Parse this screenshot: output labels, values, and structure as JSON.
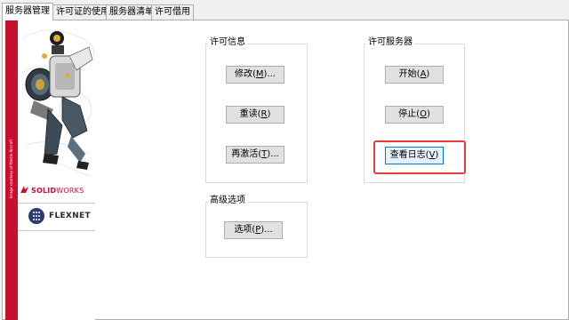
{
  "tabs": [
    {
      "label": "服务器管理",
      "active": true
    },
    {
      "label": "许可证的使用",
      "active": false
    },
    {
      "label": "服务器清单",
      "active": false
    },
    {
      "label": "许可借用",
      "active": false
    }
  ],
  "banner": {
    "logo_text_solid": "SOLID",
    "logo_text_works": "WORKS",
    "flex_logo_text": "FLEXNET",
    "vertical_caption": "Image courtesy of Martin Aircraft"
  },
  "license_info": {
    "title": "许可信息",
    "modify": {
      "label": "修改(",
      "key": "M",
      "suffix": ")..."
    },
    "reread": {
      "label": "重读(",
      "key": "R",
      "suffix": ")"
    },
    "reactivate": {
      "label": "再激活(",
      "key": "T",
      "suffix": ")..."
    }
  },
  "license_server": {
    "title": "许可服务器",
    "start": {
      "label": "开始(",
      "key": "A",
      "suffix": ")"
    },
    "stop": {
      "label": "停止(",
      "key": "O",
      "suffix": ")"
    },
    "view_log": {
      "label": "查看日志(",
      "key": "V",
      "suffix": ")"
    }
  },
  "advanced": {
    "title": "高级选项",
    "options": {
      "label": "选项(",
      "key": "P",
      "suffix": ")..."
    }
  },
  "colors": {
    "brand_red": "#c8102e",
    "highlight": "#e53b3b",
    "flexnet_blue": "#2a3d6e"
  }
}
